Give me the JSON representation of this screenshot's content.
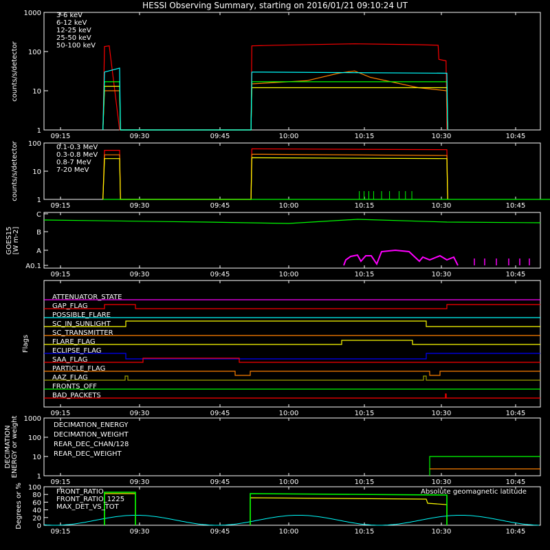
{
  "title": "HESSI Observing Summary, starting on 2016/01/21 09:10:24 UT",
  "x_ticks": [
    "09:15",
    "09:30",
    "09:45",
    "10:00",
    "10:15",
    "10:30",
    "10:45"
  ],
  "colors": {
    "red": "#ff0000",
    "orange": "#ff8000",
    "yellow": "#ffff00",
    "green": "#00ff00",
    "cyan": "#00ffff",
    "magenta": "#ff00ff",
    "blue": "#0000ff",
    "olive": "#a0a000",
    "pink": "#ff00ff"
  },
  "chart_data": [
    {
      "type": "line",
      "ylabel": "counts/s/detector",
      "yscale": "log",
      "ylim": [
        1,
        1000
      ],
      "y_ticks": [
        "1",
        "10",
        "100",
        "1000"
      ],
      "x_range_minutes": [
        9.2,
        59.0
      ],
      "series": [
        {
          "name": "3-6 keV",
          "color": "#ff0000",
          "points": [
            [
              9.2,
              1
            ],
            [
              9.3,
              135
            ],
            [
              9.6,
              140
            ],
            [
              10.25,
              1
            ],
            [
              18.5,
              1
            ],
            [
              18.55,
              140
            ],
            [
              20,
              145
            ],
            [
              25,
              158
            ],
            [
              29,
              150
            ],
            [
              30.25,
              145
            ],
            [
              30.3,
              63
            ],
            [
              30.75,
              58
            ],
            [
              30.8,
              1
            ]
          ]
        },
        {
          "name": "6-12 keV",
          "color": "#ff8000",
          "points": [
            [
              9.2,
              1
            ],
            [
              9.3,
              10
            ],
            [
              10.25,
              10
            ],
            [
              10.3,
              1
            ],
            [
              18.5,
              1
            ],
            [
              18.55,
              15
            ],
            [
              22,
              18
            ],
            [
              24,
              28
            ],
            [
              25,
              32
            ],
            [
              26,
              22
            ],
            [
              29,
              12
            ],
            [
              30.8,
              10
            ],
            [
              30.85,
              1
            ]
          ]
        },
        {
          "name": "12-25 keV",
          "color": "#ffff00",
          "points": [
            [
              9.2,
              1
            ],
            [
              9.3,
              13
            ],
            [
              10.25,
              13
            ],
            [
              10.3,
              1
            ],
            [
              18.5,
              1
            ],
            [
              18.55,
              12
            ],
            [
              30.8,
              12
            ],
            [
              30.85,
              1
            ]
          ]
        },
        {
          "name": "25-50 keV",
          "color": "#00ff00",
          "points": [
            [
              9.2,
              1
            ],
            [
              9.3,
              17
            ],
            [
              10.25,
              17
            ],
            [
              10.3,
              1
            ],
            [
              18.5,
              1
            ],
            [
              18.55,
              17
            ],
            [
              30.8,
              17
            ],
            [
              30.85,
              1
            ]
          ]
        },
        {
          "name": "50-100 keV",
          "color": "#00ffff",
          "points": [
            [
              9.2,
              1
            ],
            [
              9.3,
              30
            ],
            [
              10.25,
              38
            ],
            [
              10.3,
              1
            ],
            [
              18.5,
              1
            ],
            [
              18.55,
              30
            ],
            [
              30.8,
              28
            ],
            [
              30.85,
              1
            ]
          ]
        }
      ]
    },
    {
      "type": "line",
      "ylabel": "counts/s/detector",
      "yscale": "log",
      "ylim": [
        1,
        100
      ],
      "y_ticks": [
        "1",
        "10",
        "100"
      ],
      "series": [
        {
          "name": "0.1-0.3 MeV",
          "color": "#ff0000",
          "points": [
            [
              9.2,
              1
            ],
            [
              9.3,
              55
            ],
            [
              10.25,
              55
            ],
            [
              10.3,
              1
            ],
            [
              18.5,
              1
            ],
            [
              18.55,
              62
            ],
            [
              30.8,
              58
            ],
            [
              30.85,
              1
            ]
          ]
        },
        {
          "name": "0.3-0.8 MeV",
          "color": "#ff8000",
          "points": [
            [
              9.2,
              1
            ],
            [
              9.3,
              38
            ],
            [
              10.25,
              38
            ],
            [
              10.3,
              1
            ],
            [
              18.5,
              1
            ],
            [
              18.55,
              40
            ],
            [
              30.8,
              36
            ],
            [
              30.85,
              1
            ]
          ]
        },
        {
          "name": "0.8-7 MeV",
          "color": "#ffff00",
          "points": [
            [
              9.2,
              1
            ],
            [
              9.3,
              28
            ],
            [
              10.25,
              28
            ],
            [
              10.3,
              1
            ],
            [
              18.5,
              1
            ],
            [
              18.55,
              30
            ],
            [
              30.8,
              28
            ],
            [
              30.85,
              1
            ]
          ]
        },
        {
          "name": "7-20 MeV",
          "color": "#00ff00",
          "points": [
            [
              9.2,
              1
            ],
            [
              25,
              1
            ],
            [
              59,
              1
            ]
          ],
          "spikes": [
            25.3,
            25.6,
            25.9,
            26.2,
            26.7,
            27.2,
            27.8,
            28.2,
            28.6
          ]
        }
      ]
    },
    {
      "type": "line",
      "ylabel": "GOES15 [W m-2]",
      "y_ticks": [
        "A0.1",
        "A",
        "B",
        "C"
      ],
      "series": [
        {
          "name": "GOES long",
          "color": "#00ff00",
          "points": [
            [
              9.2,
              2.7
            ],
            [
              20,
              2.6
            ],
            [
              25,
              2.7
            ],
            [
              35,
              2.6
            ],
            [
              59,
              2.5
            ]
          ]
        },
        {
          "name": "GOES short",
          "color": "#ff00ff",
          "segments": [
            [
              24.7,
              0.05
            ],
            [
              25.3,
              0.2
            ],
            [
              26,
              0.3
            ],
            [
              26.5,
              0.1
            ],
            [
              27.2,
              0.5
            ],
            [
              28.5,
              0.5
            ],
            [
              29.8,
              0.4
            ],
            [
              30.5,
              0.2
            ],
            [
              31.2,
              0.15
            ]
          ]
        }
      ]
    },
    {
      "type": "line",
      "ylabel": "Flags",
      "flags": [
        {
          "name": "ATTENUATOR_STATE",
          "color": "#ff00ff"
        },
        {
          "name": "GAP_FLAG",
          "color": "#ff0000"
        },
        {
          "name": "POSSIBLE_FLARE",
          "color": "#00ffff"
        },
        {
          "name": "SC_IN_SUNLIGHT",
          "color": "#ffff00"
        },
        {
          "name": "SC_TRANSMITTER",
          "color": "#ff8000"
        },
        {
          "name": "FLARE_FLAG",
          "color": "#ffff00"
        },
        {
          "name": "ECLIPSE_FLAG",
          "color": "#0000ff"
        },
        {
          "name": "SAA_FLAG",
          "color": "#ff0000"
        },
        {
          "name": "PARTICLE_FLAG",
          "color": "#ff8000"
        },
        {
          "name": "AAZ_FLAG",
          "color": "#a0a000"
        },
        {
          "name": "FRONTS_OFF",
          "color": "#00ff00"
        },
        {
          "name": "BAD_PACKETS",
          "color": "#ff0000"
        }
      ]
    },
    {
      "type": "line",
      "ylabel": "DECIMATION ENERGY or weight",
      "yscale": "log",
      "ylim": [
        1,
        1000
      ],
      "y_ticks": [
        "1",
        "10",
        "100",
        "1000"
      ],
      "series": [
        {
          "name": "DECIMATION_ENERGY",
          "color": "#00ff00",
          "points": [
            [
              29.9,
              8
            ],
            [
              59,
              8
            ]
          ]
        },
        {
          "name": "DECIMATION_WEIGHT",
          "color": "#ff8000",
          "points": [
            [
              29.9,
              1.5
            ],
            [
              59,
              1.5
            ]
          ]
        },
        {
          "name": "REAR_DEC_CHAN/128",
          "color": "#00ffff",
          "points": []
        },
        {
          "name": "REAR_DEC_WEIGHT",
          "color": "#a0a000",
          "points": []
        }
      ]
    },
    {
      "type": "line",
      "ylabel": "Degrees or %",
      "ylim": [
        0,
        100
      ],
      "y_ticks": [
        "0",
        "20",
        "40",
        "60",
        "80",
        "100"
      ],
      "series": [
        {
          "name": "FRONT_RATIO",
          "color": "#ffff00",
          "points": [
            [
              9.3,
              88
            ],
            [
              10.25,
              88
            ],
            [
              18.55,
              82
            ],
            [
              29.8,
              80
            ],
            [
              30.5,
              76
            ],
            [
              30.8,
              76
            ]
          ]
        },
        {
          "name": "FRONT_RATIO_1225",
          "color": "#00ff00",
          "points": [
            [
              9.3,
              92
            ],
            [
              10.25,
              92
            ],
            [
              18.55,
              88
            ],
            [
              30.8,
              87
            ]
          ]
        },
        {
          "name": "MAX_DET_VS_TOT",
          "color": "#ff8000",
          "points": []
        },
        {
          "name": "Absolute geomagnetic latitude",
          "color": "#00ffff",
          "points": "sinusoid"
        }
      ]
    }
  ],
  "flag_labels": {
    "attenuator": "ATTENUATOR_STATE",
    "gap": "GAP_FLAG",
    "possible_flare": "POSSIBLE_FLARE",
    "sunlight": "SC_IN_SUNLIGHT",
    "transmitter": "SC_TRANSMITTER",
    "flare": "FLARE_FLAG",
    "eclipse": "ECLIPSE_FLAG",
    "saa": "SAA_FLAG",
    "particle": "PARTICLE_FLAG",
    "aaz": "AAZ_FLAG",
    "fronts_off": "FRONTS_OFF",
    "bad_packets": "BAD_PACKETS"
  },
  "legend_texts": {
    "p1": [
      "3-6 keV",
      "6-12 keV",
      "12-25 keV",
      "25-50 keV",
      "50-100 keV"
    ],
    "p2": [
      "0.1-0.3 MeV",
      "0.3-0.8 MeV",
      "0.8-7 MeV",
      "7-20 MeV"
    ],
    "p5": [
      "DECIMATION_ENERGY",
      "DECIMATION_WEIGHT",
      "REAR_DEC_CHAN/128",
      "REAR_DEC_WEIGHT"
    ],
    "p6": [
      "FRONT_RATIO",
      "FRONT_RATIO_1225",
      "MAX_DET_VS_TOT"
    ],
    "p6_right": "Absolute geomagnetic latitude"
  },
  "goes_ylabel": "GOES15\n[W m-2]",
  "p5_ylabel_lines": [
    "DECIMATION",
    "ENERGY or weight"
  ]
}
